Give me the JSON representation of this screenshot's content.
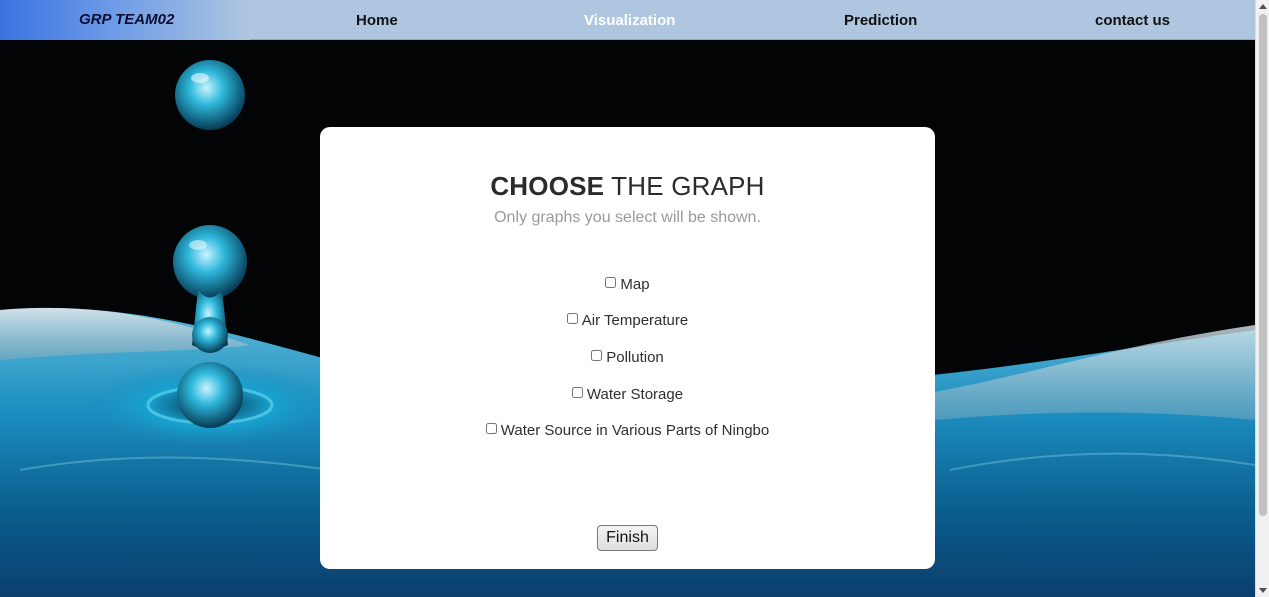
{
  "navbar": {
    "brand": "GRP TEAM02",
    "links": [
      "Home",
      "Visualization",
      "Prediction",
      "contact us"
    ],
    "active": "Visualization"
  },
  "card": {
    "title_strong": "CHOOSE",
    "title_rest": " THE GRAPH",
    "subtitle": "Only graphs you select will be shown.",
    "options": [
      {
        "label": "Map",
        "checked": false
      },
      {
        "label": "Air Temperature",
        "checked": false
      },
      {
        "label": "Pollution",
        "checked": false
      },
      {
        "label": "Water Storage",
        "checked": false
      },
      {
        "label": "Water Source in Various Parts of Ningbo",
        "checked": false
      }
    ],
    "finish_label": "Finish"
  },
  "colors": {
    "nav_bg": "#aec6df",
    "brand_gradient_start": "#3a73e0",
    "active_link": "#ffffff",
    "water_accent": "#1ba6cf"
  },
  "icons": {
    "scroll_up": "triangle-up-icon",
    "scroll_down": "triangle-down-icon"
  }
}
